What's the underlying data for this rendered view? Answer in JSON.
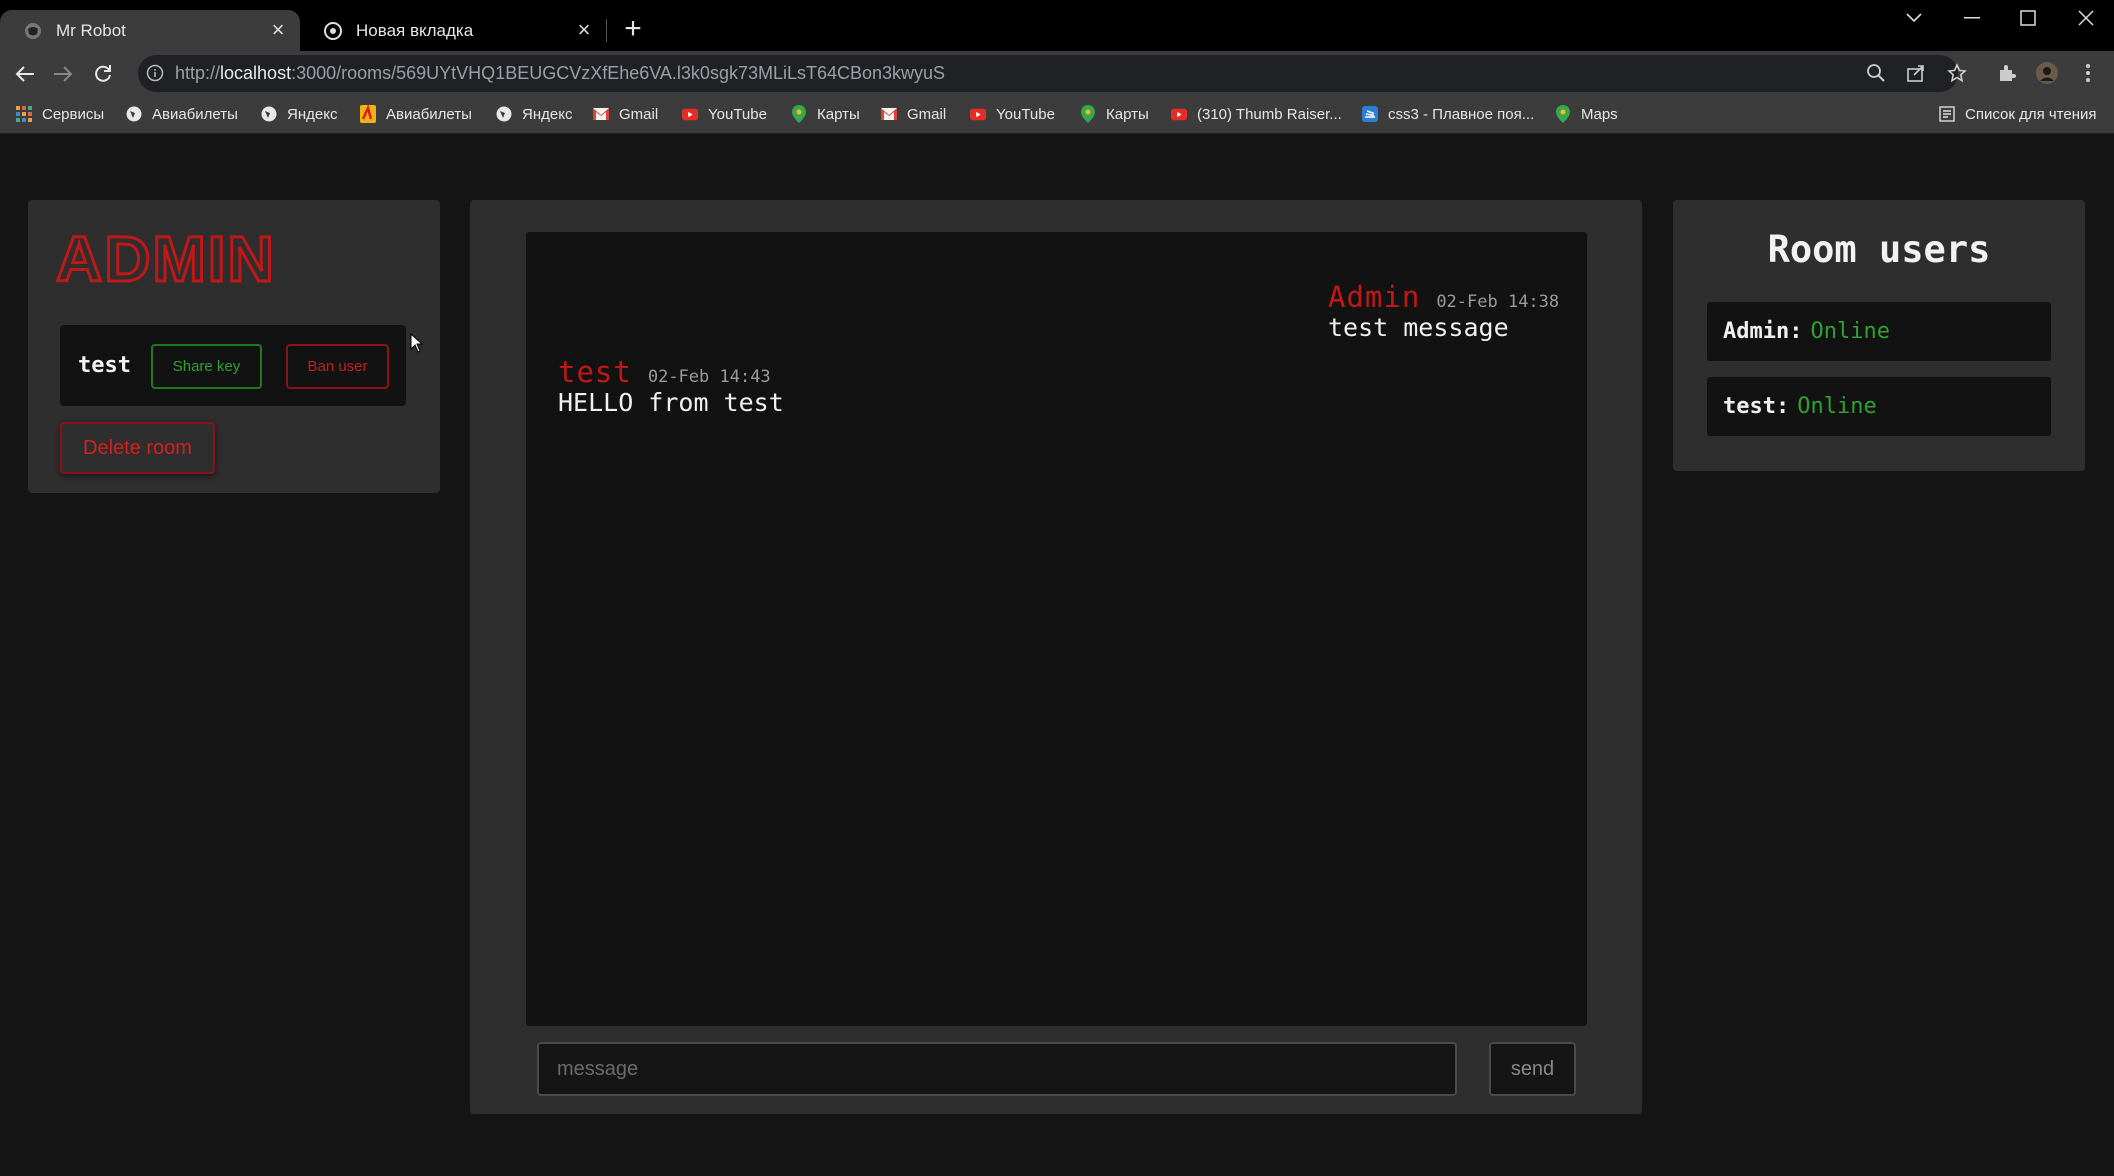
{
  "browser": {
    "tabs": [
      {
        "title": "Mr Robot",
        "active": true
      },
      {
        "title": "Новая вкладка",
        "active": false
      }
    ],
    "url_prefix": "http://",
    "url_host": "localhost",
    "url_rest": ":3000/rooms/569UYtVHQ1BEUGCVzXfEhe6VA.l3k0sgk73MLiLsT64CBon3kwyuS",
    "bookmarks": [
      {
        "label": "Сервисы",
        "icon": "apps-grid-icon"
      },
      {
        "label": "Авиабилеты",
        "icon": "globe-icon"
      },
      {
        "label": "Яндекс",
        "icon": "globe-icon"
      },
      {
        "label": "Авиабилеты",
        "icon": "aviasales-icon"
      },
      {
        "label": "Яндекс",
        "icon": "globe-icon"
      },
      {
        "label": "Gmail",
        "icon": "gmail-icon"
      },
      {
        "label": "YouTube",
        "icon": "youtube-icon"
      },
      {
        "label": "Карты",
        "icon": "maps-pin-icon"
      },
      {
        "label": "Gmail",
        "icon": "gmail-icon"
      },
      {
        "label": "YouTube",
        "icon": "youtube-icon"
      },
      {
        "label": "Карты",
        "icon": "maps-pin-icon"
      },
      {
        "label": "(310) Thumb Raiser...",
        "icon": "youtube-icon"
      },
      {
        "label": "css3 - Плавное поя...",
        "icon": "stackoverflow-icon"
      },
      {
        "label": "Maps",
        "icon": "maps-pin-icon"
      }
    ],
    "reading_list": "Список для чтения"
  },
  "admin_panel": {
    "logo_text": "ADMIN",
    "user": {
      "name": "test",
      "share_label": "Share key",
      "ban_label": "Ban user"
    },
    "delete_label": "Delete room"
  },
  "chat": {
    "messages": [
      {
        "author": "Admin",
        "time": "02-Feb 14:38",
        "text": "test message",
        "align": "right"
      },
      {
        "author": "test",
        "time": "02-Feb 14:43",
        "text": "HELLO from test",
        "align": "left"
      }
    ],
    "input_placeholder": "message",
    "send_label": "send"
  },
  "room_users": {
    "title": "Room users",
    "users": [
      {
        "name": "Admin:",
        "status": "Online"
      },
      {
        "name": "test:",
        "status": "Online"
      }
    ]
  },
  "colors": {
    "accent_red": "#c01818",
    "online_green": "#2fa12f",
    "panel_bg": "#2e2e2e",
    "page_bg": "#151515"
  }
}
